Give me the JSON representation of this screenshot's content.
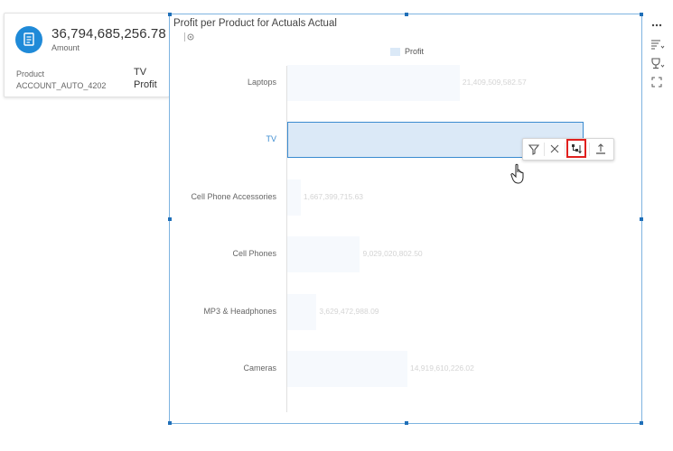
{
  "tooltip": {
    "amount_value": "36,794,685,256.78",
    "amount_label": "Amount",
    "dimension_label": "Product",
    "dimension_id": "ACCOUNT_AUTO_4202",
    "dimension_value": "TV",
    "measure_value": "Profit",
    "icon": "document-icon"
  },
  "widget": {
    "title": "Profit per Product for Actuals Actual",
    "legend_label": "Profit"
  },
  "colors": {
    "bar": "#f6f9fd",
    "bar_selected": "#dbe9f7",
    "selection_border": "#3a8bd0",
    "highlight_box": "#e0201e",
    "tooltip_icon": "#1f8ad8"
  },
  "context_toolbar": {
    "buttons": [
      "filter-icon",
      "exclude-icon",
      "drill-down-icon",
      "upload-icon"
    ],
    "highlighted": "drill-down-icon"
  },
  "side_toolbar": {
    "buttons": [
      "more-options-icon",
      "sort-icon",
      "ranking-icon",
      "fullscreen-icon"
    ]
  },
  "chart_data": {
    "type": "bar",
    "orientation": "horizontal",
    "categories": [
      "Laptops",
      "TV",
      "Cell Phone Accessories",
      "Cell Phones",
      "MP3 & Headphones",
      "Cameras"
    ],
    "series": [
      {
        "name": "Profit",
        "values": [
          21409509582.57,
          36794685256.78,
          1667399715.63,
          9029020802.5,
          3629472988.09,
          14919610226.02
        ],
        "value_labels": [
          "21,409,509,582.57",
          "",
          "1,667,399,715.63",
          "9,029,020,802.50",
          "3,629,472,988.09",
          "14,919,610,226.02"
        ]
      }
    ],
    "selected_category": "TV",
    "legend_position": "top"
  }
}
